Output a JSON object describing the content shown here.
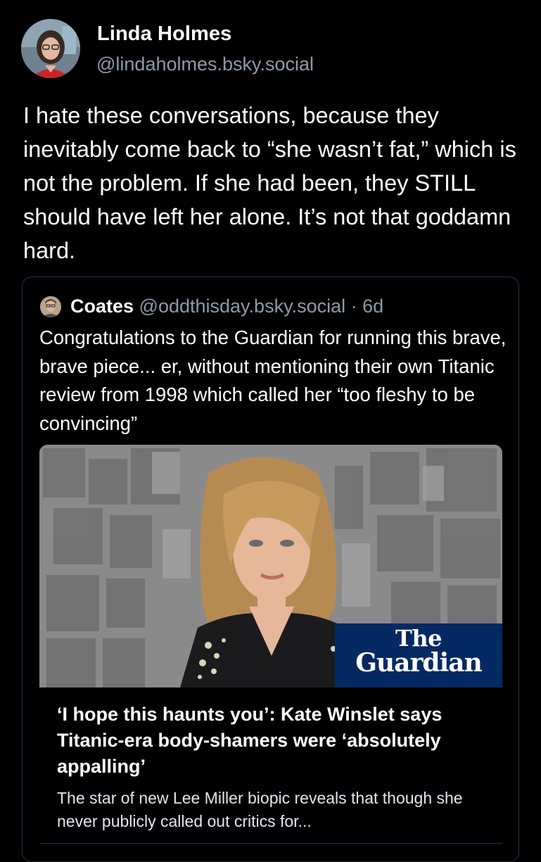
{
  "post": {
    "author_name": "Linda Holmes",
    "author_handle": "@lindaholmes.bsky.social",
    "text": "I hate these conversations, because they inevitably come back to “she wasn’t fat,” which is not the problem. If she had been, they STILL should have left her alone. It’s not that goddamn hard."
  },
  "quote": {
    "author_name": "Coates",
    "author_handle": "@oddthisday.bsky.social",
    "separator": " · ",
    "age": "6d",
    "text": "Congratulations to the Guardian for running this brave, brave piece... er, without mentioning their own Titanic review from 1998 which called her “too fleshy to be convincing”"
  },
  "link_card": {
    "logo_line1": "The",
    "logo_line2": "Guardian",
    "title": "‘I hope this haunts you’: Kate Winslet says Titanic-era body-shamers were ‘absolutely appalling’",
    "description": "The star of new Lee Miller biopic reveals that though she never publicly called out critics for...",
    "logo_color": "#052962"
  },
  "colors": {
    "background": "#000000",
    "text_primary": "#ffffff",
    "text_secondary": "#8e9aa8",
    "border": "#2b3440"
  },
  "icons": {
    "author_avatar": "avatar-photo",
    "quote_avatar": "avatar-photo"
  }
}
